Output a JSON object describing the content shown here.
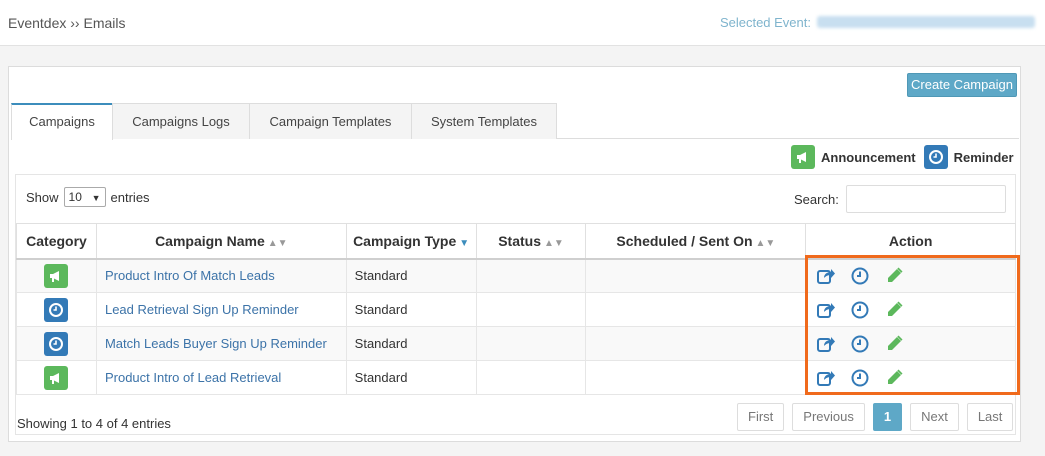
{
  "breadcrumb": "Eventdex ›› Emails",
  "selected_event_label": "Selected Event:",
  "create_campaign_label": "Create Campaign",
  "tabs": [
    {
      "label": "Campaigns",
      "active": true
    },
    {
      "label": "Campaigns Logs",
      "active": false
    },
    {
      "label": "Campaign Templates",
      "active": false
    },
    {
      "label": "System Templates",
      "active": false
    }
  ],
  "legend": {
    "announcement": {
      "label": "Announcement",
      "icon": "megaphone-icon",
      "color": "#5cb85c"
    },
    "reminder": {
      "label": "Reminder",
      "icon": "clock-icon",
      "color": "#337ab7"
    }
  },
  "length_menu": {
    "prefix": "Show",
    "value": "10",
    "suffix": "entries"
  },
  "search": {
    "label": "Search:",
    "value": ""
  },
  "table": {
    "headers": [
      "Category",
      "Campaign Name",
      "Campaign Type",
      "Status",
      "Scheduled / Sent On",
      "Action"
    ],
    "rows": [
      {
        "category": "announcement",
        "name": "Product Intro Of Match Leads",
        "type": "Standard",
        "status": "",
        "scheduled": ""
      },
      {
        "category": "reminder",
        "name": "Lead Retrieval Sign Up Reminder",
        "type": "Standard",
        "status": "",
        "scheduled": ""
      },
      {
        "category": "reminder",
        "name": "Match Leads Buyer Sign Up Reminder",
        "type": "Standard",
        "status": "",
        "scheduled": ""
      },
      {
        "category": "announcement",
        "name": "Product Intro of Lead Retrieval",
        "type": "Standard",
        "status": "",
        "scheduled": ""
      }
    ]
  },
  "footer": {
    "info": "Showing 1 to 4 of 4 entries",
    "pagination": {
      "first": "First",
      "previous": "Previous",
      "current": "1",
      "next": "Next",
      "last": "Last"
    }
  },
  "colors": {
    "accent": "#3c8dbc",
    "button": "#5ea8c7",
    "highlight": "#f06a1c",
    "link": "#3c73a8"
  }
}
